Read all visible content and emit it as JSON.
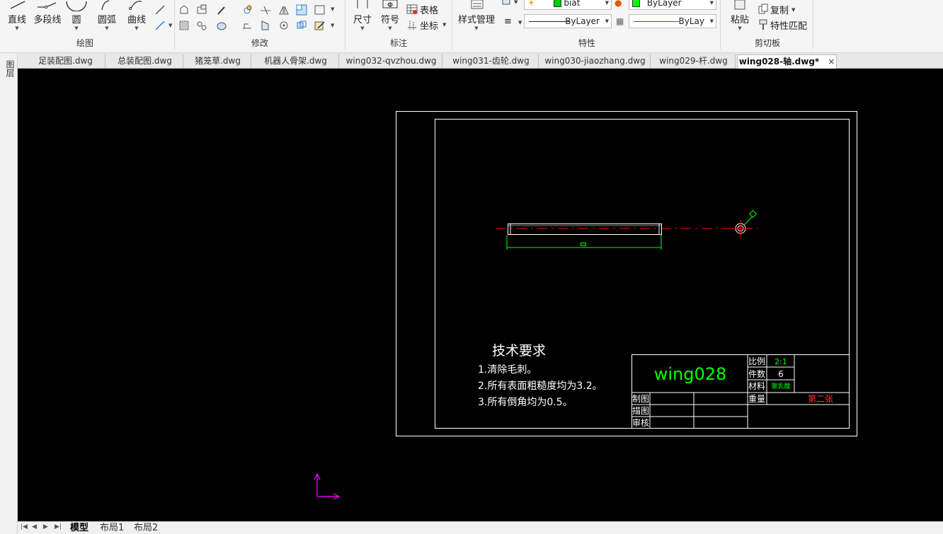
{
  "ribbon": {
    "draw": {
      "title": "绘图",
      "line": "直线",
      "polyline": "多段线",
      "circle": "圆",
      "arc": "圆弧",
      "curve": "曲线"
    },
    "modify": {
      "title": "修改"
    },
    "annotate": {
      "title": "标注",
      "dimension": "尺寸",
      "symbol": "符号",
      "table": "表格",
      "coordinate": "坐标"
    },
    "style": {
      "label": "样式管理"
    },
    "properties": {
      "title": "特性",
      "layer_value": "biat",
      "color_value": "ByLayer",
      "linetype_value": "ByLayer",
      "lineweight_value": "ByLay"
    },
    "clipboard": {
      "title": "剪切板",
      "paste": "粘贴",
      "copy": "复制",
      "match": "特性匹配"
    }
  },
  "leftstrip": {
    "label": "图层"
  },
  "tabs": [
    "足装配图.dwg",
    "总装配图.dwg",
    "猪笼草.dwg",
    "机器人骨架.dwg",
    "wing032-qvzhou.dwg",
    "wing031-齿轮.dwg",
    "wing030-jiaozhang.dwg",
    "wing029-杆.dwg",
    "wing028-轴.dwg*"
  ],
  "tab_close": "×",
  "drawing": {
    "tech_title": "技术要求",
    "tech_items": [
      "1.清除毛刺。",
      "2.所有表面粗糙度均为3.2。",
      "3.所有倒角均为0.5。"
    ],
    "part_name": "wing028",
    "scale_label": "比例",
    "scale_value": "2:1",
    "count_label": "件数",
    "count_value": "6",
    "material_label": "材料",
    "material_value": "聚乳酸",
    "weight_label": "重量",
    "sheet_value": "第二张",
    "draw_label": "制图",
    "trace_label": "描图",
    "review_label": "审核"
  },
  "bottom": {
    "nav": [
      "|◀",
      "◀",
      "▶",
      "▶|"
    ],
    "layouts": [
      "模型",
      "布局1",
      "布局2"
    ]
  },
  "colors": {
    "canvas": "#000000",
    "cad_white": "#ffffff",
    "cad_green": "#00ff00",
    "cad_red": "#ff0000",
    "cad_magenta": "#ff00ff"
  }
}
